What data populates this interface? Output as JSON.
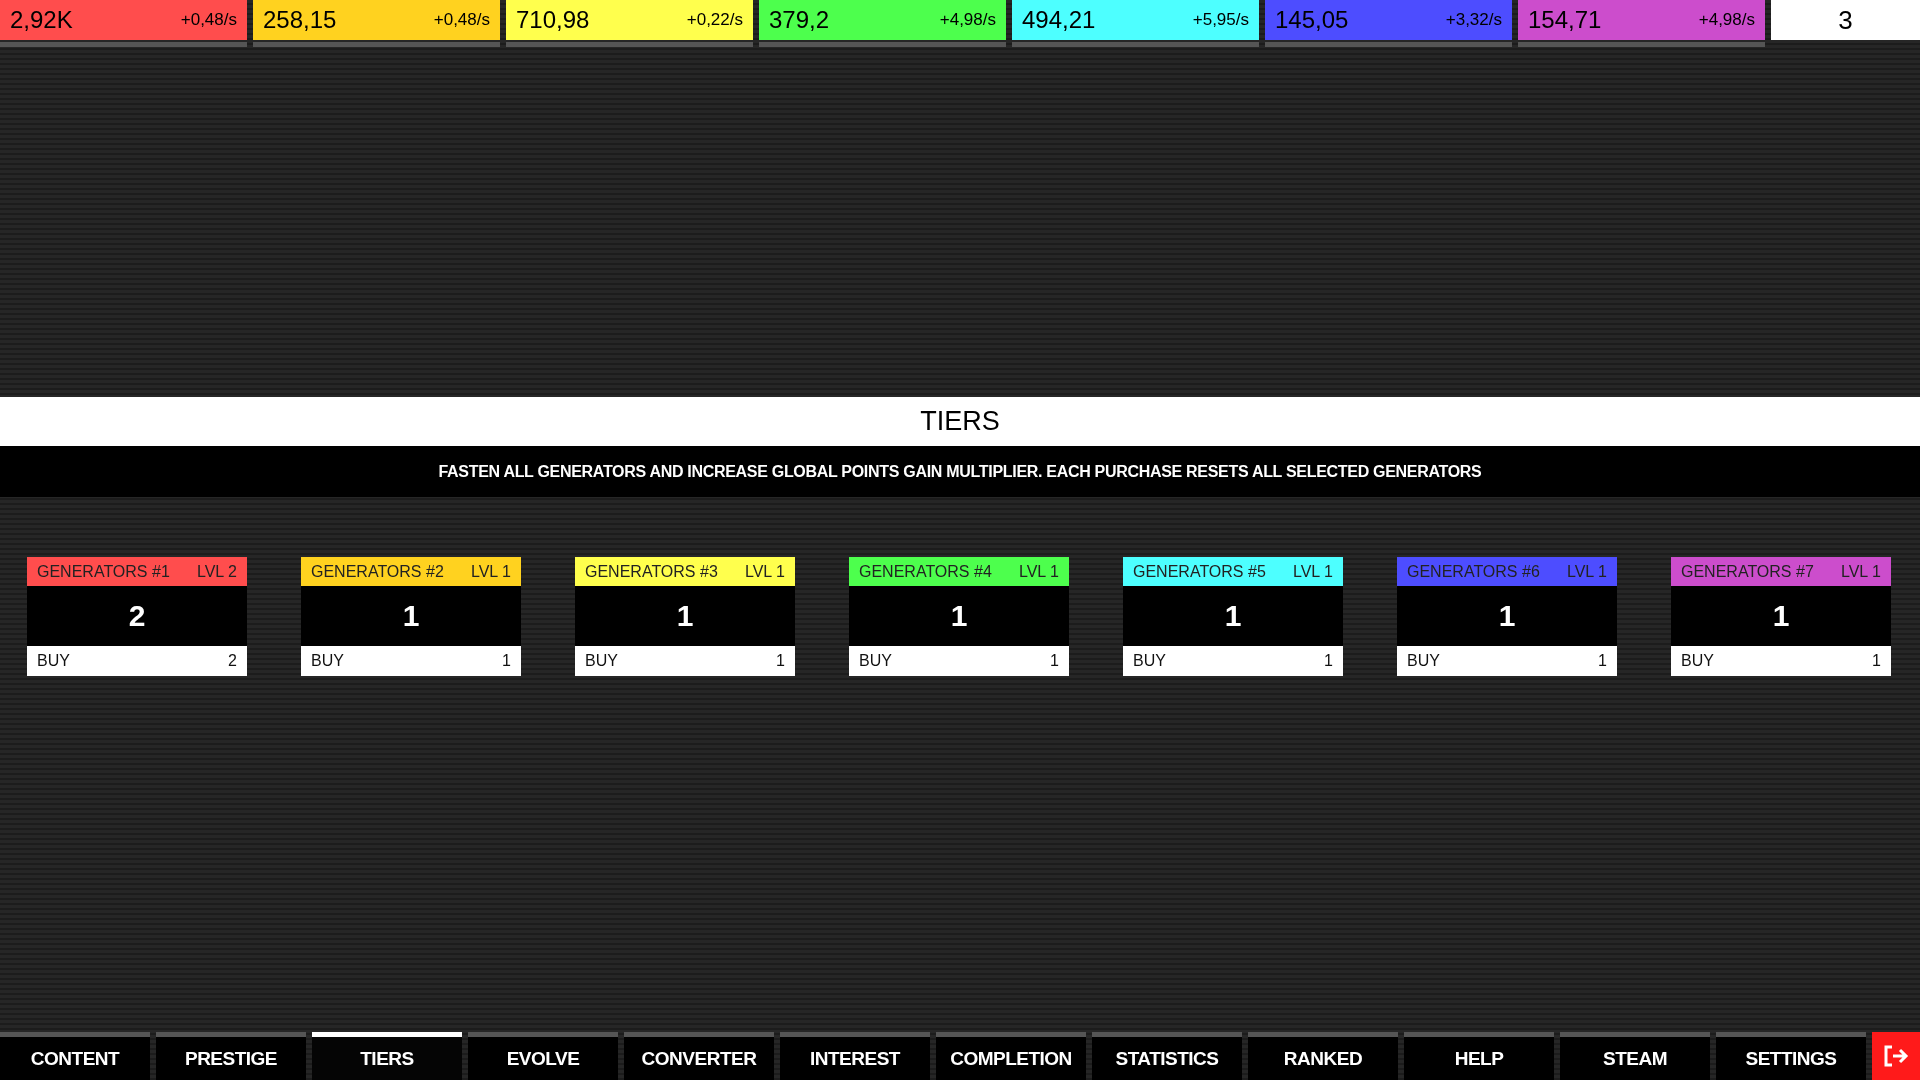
{
  "resources": [
    {
      "value": "2,92K",
      "rate": "+0,48/s",
      "color": "#ff4d4d"
    },
    {
      "value": "258,15",
      "rate": "+0,48/s",
      "color": "#ffd21f"
    },
    {
      "value": "710,98",
      "rate": "+0,22/s",
      "color": "#ffff4d"
    },
    {
      "value": "379,2",
      "rate": "+4,98/s",
      "color": "#4dff4d"
    },
    {
      "value": "494,21",
      "rate": "+5,95/s",
      "color": "#4dffff"
    },
    {
      "value": "145,05",
      "rate": "+3,32/s",
      "color": "#4d4dff"
    },
    {
      "value": "154,71",
      "rate": "+4,98/s",
      "color": "#cc4dcc"
    }
  ],
  "counter": "3",
  "section_title": "TIERS",
  "description": "FASTEN ALL GENERATORS AND INCREASE GLOBAL POINTS GAIN MULTIPLIER. EACH PURCHASE RESETS ALL SELECTED GENERATORS",
  "tiers": [
    {
      "name": "GENERATORS #1",
      "level": "LVL 2",
      "value": "2",
      "buy": "BUY",
      "cost": "2",
      "color": "#ff4d4d"
    },
    {
      "name": "GENERATORS #2",
      "level": "LVL 1",
      "value": "1",
      "buy": "BUY",
      "cost": "1",
      "color": "#ffd21f"
    },
    {
      "name": "GENERATORS #3",
      "level": "LVL 1",
      "value": "1",
      "buy": "BUY",
      "cost": "1",
      "color": "#ffff4d"
    },
    {
      "name": "GENERATORS #4",
      "level": "LVL 1",
      "value": "1",
      "buy": "BUY",
      "cost": "1",
      "color": "#4dff4d"
    },
    {
      "name": "GENERATORS #5",
      "level": "LVL 1",
      "value": "1",
      "buy": "BUY",
      "cost": "1",
      "color": "#4dffff"
    },
    {
      "name": "GENERATORS #6",
      "level": "LVL 1",
      "value": "1",
      "buy": "BUY",
      "cost": "1",
      "color": "#4d4dff"
    },
    {
      "name": "GENERATORS #7",
      "level": "LVL 1",
      "value": "1",
      "buy": "BUY",
      "cost": "1",
      "color": "#cc4dcc"
    }
  ],
  "tabs": [
    {
      "label": "CONTENT",
      "selected": false
    },
    {
      "label": "PRESTIGE",
      "selected": false
    },
    {
      "label": "TIERS",
      "selected": true
    },
    {
      "label": "EVOLVE",
      "selected": false
    },
    {
      "label": "CONVERTER",
      "selected": false
    },
    {
      "label": "INTEREST",
      "selected": false
    },
    {
      "label": "COMPLETION",
      "selected": false
    },
    {
      "label": "STATISTICS",
      "selected": false
    },
    {
      "label": "RANKED",
      "selected": false
    },
    {
      "label": "HELP",
      "selected": false
    },
    {
      "label": "STEAM",
      "selected": false
    },
    {
      "label": "SETTINGS",
      "selected": false
    }
  ]
}
